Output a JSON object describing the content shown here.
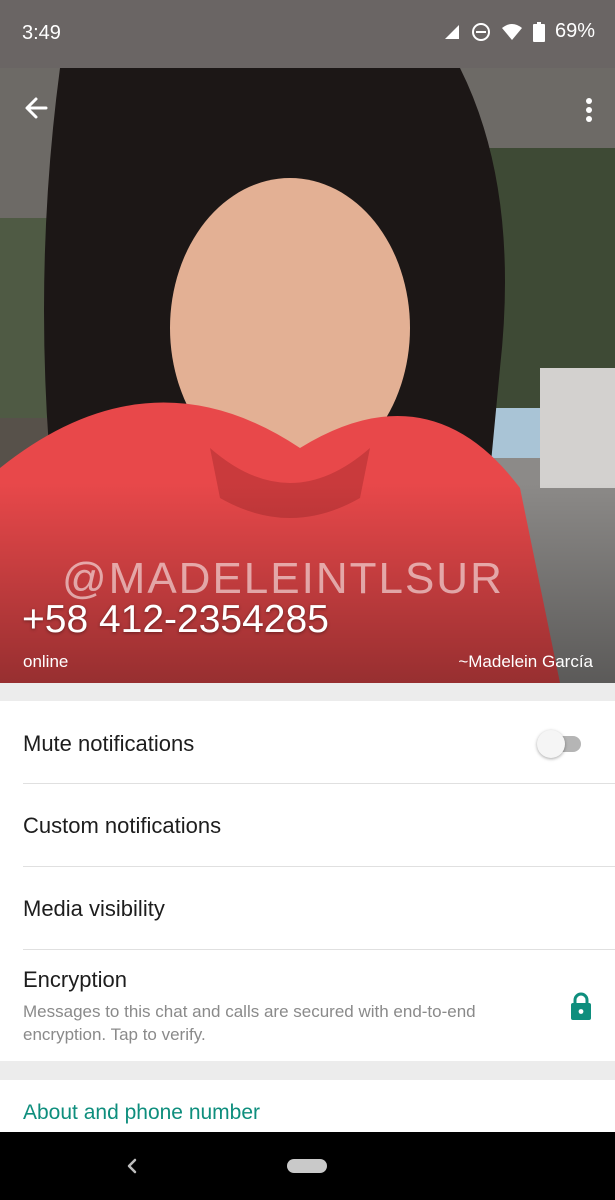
{
  "status_bar": {
    "time": "3:49",
    "battery": "69%",
    "icons": [
      "signal-icon",
      "do-not-disturb-icon",
      "wifi-icon",
      "battery-icon"
    ]
  },
  "header": {
    "phone": "+58 412-2354285",
    "status": "online",
    "push_name": "~Madelein García",
    "watermark": "@MADELEINTLSUR",
    "icons": [
      "arrow-back-icon",
      "more-vert-icon"
    ]
  },
  "settings": {
    "mute_label": "Mute notifications",
    "mute_enabled": false,
    "custom_label": "Custom notifications",
    "media_label": "Media visibility",
    "encryption_title": "Encryption",
    "encryption_desc": "Messages to this chat and calls are secured with end-to-end encryption. Tap to verify."
  },
  "about": {
    "label": "About and phone number"
  },
  "colors": {
    "accent": "#0e8e7d",
    "status_bar": "#6a6564",
    "toggle_off": "#b5b5b5"
  }
}
